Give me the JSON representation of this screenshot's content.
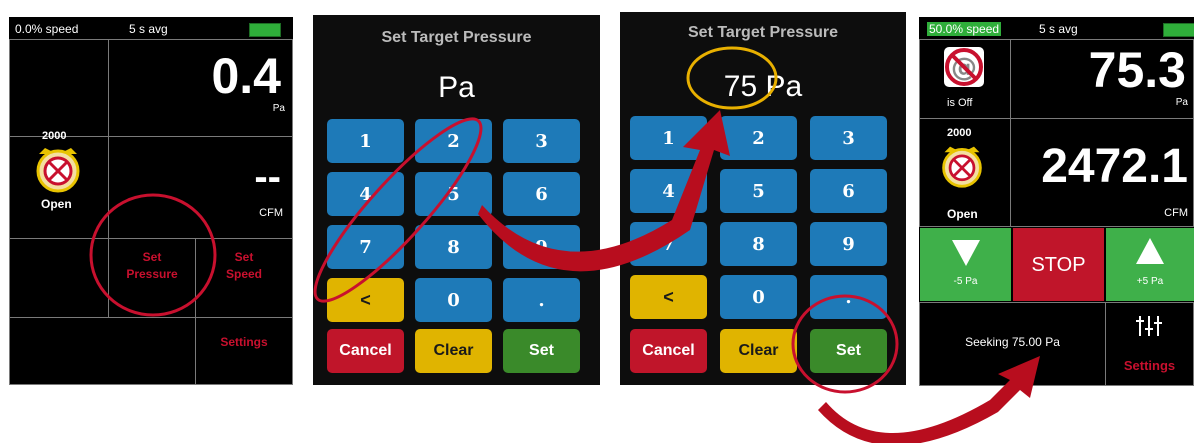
{
  "screen1": {
    "speed": "0.0% speed",
    "avg": "5 s avg",
    "pressure_value": "0.4",
    "pressure_unit": "Pa",
    "ring_label": "2000",
    "status": "Open",
    "flow_value": "--",
    "flow_unit": "CFM",
    "set_pressure": "Set\nPressure",
    "set_speed": "Set\nSpeed",
    "settings": "Settings"
  },
  "keypad1": {
    "title": "Set Target Pressure",
    "display": "Pa",
    "keys": [
      "1",
      "2",
      "3",
      "4",
      "5",
      "6",
      "7",
      "8",
      "9",
      "<",
      "0",
      "."
    ],
    "cancel": "Cancel",
    "clear": "Clear",
    "set": "Set"
  },
  "keypad2": {
    "title": "Set Target Pressure",
    "display": "75 Pa",
    "keys": [
      "1",
      "2",
      "3",
      "4",
      "5",
      "6",
      "7",
      "8",
      "9",
      "<",
      "0",
      "."
    ],
    "cancel": "Cancel",
    "clear": "Clear",
    "set": "Set"
  },
  "screen4": {
    "speed": "50.0% speed",
    "avg": "5 s avg",
    "off_label": "is Off",
    "pressure_value": "75.3",
    "pressure_unit": "Pa",
    "ring_label": "2000",
    "status": "Open",
    "flow_value": "2472.1",
    "flow_unit": "CFM",
    "minus_label": "-5 Pa",
    "stop_label": "STOP",
    "plus_label": "+5 Pa",
    "seeking": "Seeking 75.00 Pa",
    "settings": "Settings"
  },
  "colors": {
    "annotation": "#c8102e",
    "highlight": "#e8b000",
    "key_blue": "#1e7ab8",
    "green": "#2fae3a"
  }
}
